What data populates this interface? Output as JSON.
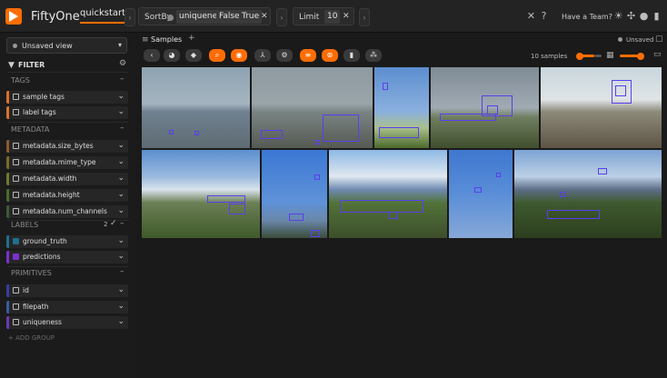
{
  "app": {
    "name": "FiftyOne",
    "dataset": "quickstart"
  },
  "header": {
    "sort_label": "SortBy",
    "sort_field": "uniqueness",
    "sort_opt_false": "False",
    "sort_opt_true": "True",
    "limit_label": "Limit",
    "limit_value": "10",
    "team_link": "Have a Team?"
  },
  "sidebar": {
    "view": "Unsaved view",
    "filter_title": "FILTER",
    "groups": {
      "tags": "TAGS",
      "metadata": "METADATA",
      "labels": "LABELS",
      "labels_count": "2",
      "primitives": "PRIMITIVES"
    },
    "tags": [
      "sample tags",
      "label tags"
    ],
    "metadata": [
      "metadata.size_bytes",
      "metadata.mime_type",
      "metadata.width",
      "metadata.height",
      "metadata.num_channels"
    ],
    "labels": [
      "ground_truth",
      "predictions"
    ],
    "primitives": [
      "id",
      "filepath",
      "uniqueness"
    ],
    "add_group": "+ ADD GROUP"
  },
  "main": {
    "tab": "Samples",
    "status": "Unsaved",
    "sample_count": "10 samples"
  },
  "colors": {
    "accent": "#ff6d04",
    "label_ground_truth": "#1f6f8b",
    "label_predictions": "#7b2fd0"
  }
}
